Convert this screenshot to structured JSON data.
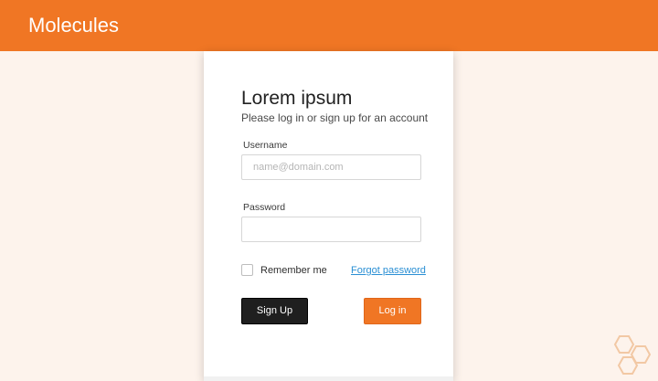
{
  "app": {
    "title": "Molecules"
  },
  "login": {
    "heading": "Lorem ipsum",
    "subheading": "Please log in or sign up for an account",
    "username_label": "Username",
    "username_placeholder": "name@domain.com",
    "username_value": "",
    "password_label": "Password",
    "password_value": "",
    "remember_label": "Remember me",
    "remember_checked": false,
    "forgot_label": "Forgot password",
    "signup_label": "Sign Up",
    "login_label": "Log in"
  },
  "decoration": {
    "icon": "hexagon-molecule-icon"
  },
  "colors": {
    "brand": "#f07624",
    "background": "#fdf3ec",
    "link": "#2a8fd4",
    "dark_button": "#1f1f1f"
  }
}
